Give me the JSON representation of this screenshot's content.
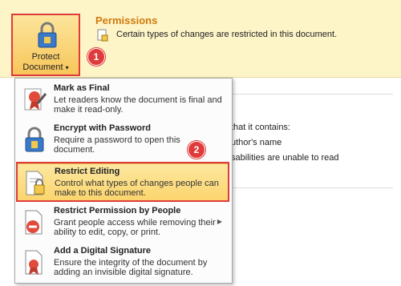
{
  "protect_button": {
    "line1": "Protect",
    "line2": "Document",
    "caret": "▾"
  },
  "permissions": {
    "title": "Permissions",
    "description": "Certain types of changes are restricted in this document."
  },
  "badges": {
    "b1": "1",
    "b2": "2"
  },
  "background": {
    "t1": "that it contains:",
    "t2": "uthor's name",
    "t3": "sabilities are unable to read"
  },
  "menu": {
    "items": [
      {
        "title": "Mark as Final",
        "desc": "Let readers know the document is final and make it read-only.",
        "icon": "ribbon-pen-icon"
      },
      {
        "title": "Encrypt with Password",
        "desc": "Require a password to open this document.",
        "icon": "lock-keys-icon"
      },
      {
        "title": "Restrict Editing",
        "desc": "Control what types of changes people can make to this document.",
        "icon": "document-lock-icon"
      },
      {
        "title": "Restrict Permission by People",
        "desc": "Grant people access while removing their ability to edit, copy, or print.",
        "icon": "document-forbidden-icon"
      },
      {
        "title": "Add a Digital Signature",
        "desc": "Ensure the integrity of the document by adding an invisible digital signature.",
        "icon": "document-seal-icon"
      }
    ]
  },
  "colors": {
    "accent": "#d07a0b",
    "highlight": "#fbd46c",
    "callout": "#e03b3b"
  }
}
